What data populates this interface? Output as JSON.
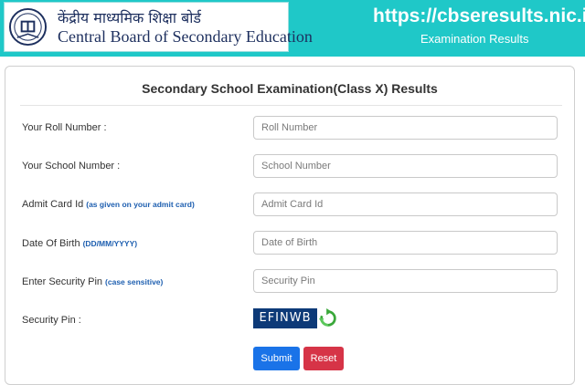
{
  "header": {
    "board_name_hindi": "केंद्रीय माध्यमिक शिक्षा बोर्ड",
    "board_name_english": "Central Board of Secondary Education",
    "site_url": "https://cbseresults.nic.in",
    "site_subtitle": "Examination Results",
    "background_color": "#1fc8c8"
  },
  "form": {
    "title": "Secondary School Examination(Class X) Results",
    "fields": [
      {
        "label": "Your Roll Number :",
        "hint": "",
        "placeholder": "Roll Number",
        "value": ""
      },
      {
        "label": "Your School Number :",
        "hint": "",
        "placeholder": "School Number",
        "value": ""
      },
      {
        "label": "Admit Card Id",
        "hint": "(as given on your admit card)",
        "placeholder": "Admit Card Id",
        "value": ""
      },
      {
        "label": "Date Of Birth",
        "hint": "(DD/MM/YYYY)",
        "placeholder": "Date of Birth",
        "value": ""
      },
      {
        "label": "Enter Security Pin",
        "hint": "(case sensitive)",
        "placeholder": "Security Pin",
        "value": ""
      }
    ],
    "security_pin": {
      "label": "Security Pin :",
      "captcha_text": "EFINWB",
      "captcha_bg_color": "#0d3a78",
      "refresh_icon": "refresh-icon"
    },
    "buttons": {
      "submit_label": "Submit",
      "submit_color": "#1a73e8",
      "reset_label": "Reset",
      "reset_color": "#d63447"
    }
  }
}
